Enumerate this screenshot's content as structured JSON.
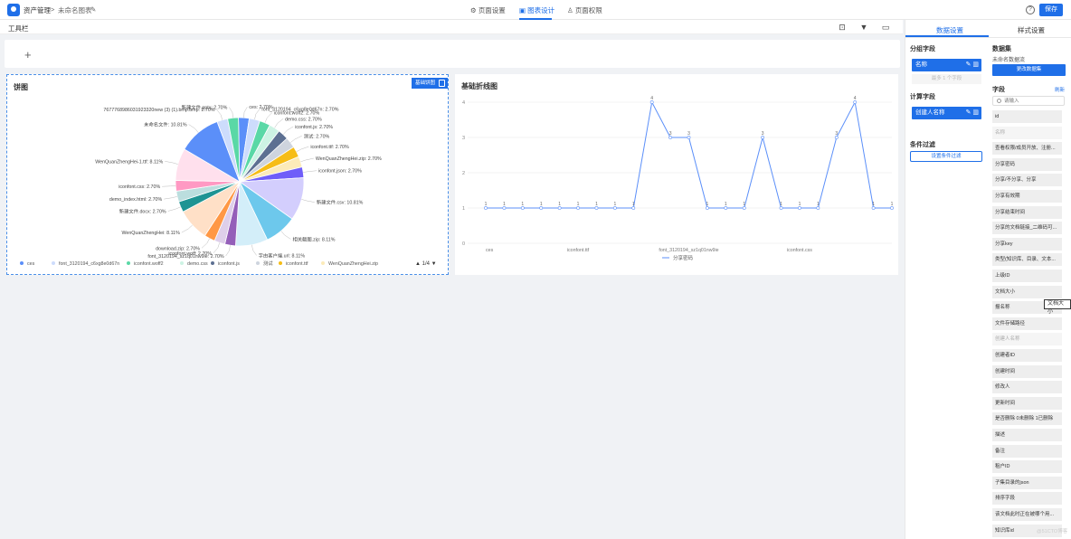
{
  "header": {
    "app_name": "资产管理",
    "separator": ">",
    "chart_name": "未命名图表",
    "tabs": [
      {
        "label": "页面设置",
        "icon": "gear-icon"
      },
      {
        "label": "图表设计",
        "icon": "chart-design-icon",
        "active": true
      },
      {
        "label": "页面权限",
        "icon": "user-permission-icon"
      }
    ],
    "save_label": "保存",
    "help_label": "?"
  },
  "toolbar": {
    "title": "工具栏",
    "add_label": "+"
  },
  "pie_card": {
    "title": "饼图",
    "badge_label": "基础饼图",
    "legend": [
      "ces",
      "font_3120194_c6xg8e0d67n",
      "iconfont.woff2",
      "demo.css",
      "iconfont.js",
      "测试",
      "iconfont.ttf",
      "WenQuanZhengHei.zip"
    ],
    "pager": "1/4"
  },
  "line_card": {
    "title": "基础折线图",
    "legend_label": "分享密码"
  },
  "right_panel": {
    "tabs": [
      "数据设置",
      "样式设置"
    ],
    "group_title": "分组字段",
    "group_field": "名称",
    "group_hint": "最多 1 个字段",
    "calc_title": "计算字段",
    "calc_field": "创建人名称",
    "filter_title": "条件过滤",
    "filter_button": "设置条件过滤",
    "dataset_title": "数据集",
    "dataset_name": "未命名数据流",
    "dataset_button": "更改数据集",
    "fields_title": "字段",
    "refresh_label": "刷新",
    "search_placeholder": "请输入",
    "fields": [
      "id",
      "名称",
      "查看权限/成员开放、注册...",
      "分享密码",
      "分享/不分享、分享",
      "分享有效期",
      "分享结束时间",
      "分享的文档链接_二维码可...",
      "分享key",
      "类型(知识库、目录、文本...",
      "上级ID",
      "文档大小",
      "报名称",
      "文件存储路径",
      "创建人名称",
      "创建者ID",
      "创建时间",
      "修改人",
      "更新时间",
      "是否删除 0未删除 1已删除",
      "描述",
      "备注",
      "租户ID",
      "子集目录的json",
      "排序字段",
      "该文档此时正在被哪个用...",
      "知识库id"
    ],
    "disabled_fields": [
      1,
      14
    ],
    "tooltip": "文档大小"
  },
  "watermark": "@51CTO博客",
  "colors": {
    "accent": "#1f6fe8"
  },
  "chart_data": [
    {
      "type": "pie",
      "title": "饼图",
      "slices": [
        {
          "label": "ces",
          "value": 2.7,
          "color": "#5b8ff9"
        },
        {
          "label": "font_3120194_c6xg8e0d67n",
          "value": 2.7,
          "color": "#cddcfc"
        },
        {
          "label": "iconfont.woff2",
          "value": 2.7,
          "color": "#5ad8a6"
        },
        {
          "label": "demo.css",
          "value": 2.7,
          "color": "#cdf3e4"
        },
        {
          "label": "iconfont.js",
          "value": 2.7,
          "color": "#5d7092"
        },
        {
          "label": "测试",
          "value": 2.7,
          "color": "#ced4de"
        },
        {
          "label": "iconfont.ttf",
          "value": 2.7,
          "color": "#f6bd16"
        },
        {
          "label": "WenQuanZhengHei.zip",
          "value": 2.7,
          "color": "#fcebb9"
        },
        {
          "label": "iconfont.json",
          "value": 2.7,
          "color": "#6f5ef9"
        },
        {
          "label": "新建文件.csv",
          "value": 10.81,
          "color": "#d3cefd"
        },
        {
          "label": "相关截图.zip",
          "value": 8.11,
          "color": "#6dc8ec"
        },
        {
          "label": "字由客户端.url",
          "value": 8.11,
          "color": "#d3eef9"
        },
        {
          "label": "font_3120194_sz1q01nw9ie",
          "value": 2.7,
          "color": "#945fb9"
        },
        {
          "label": "iconfont.woff",
          "value": 2.7,
          "color": "#decfea"
        },
        {
          "label": "download.zip",
          "value": 2.7,
          "color": "#ff9845"
        },
        {
          "label": "WenQuanZhengHei",
          "value": 8.11,
          "color": "#ffe0c7"
        },
        {
          "label": "新建文件.docx",
          "value": 2.7,
          "color": "#1e9493"
        },
        {
          "label": "demo_index.html",
          "value": 2.7,
          "color": "#bbdede"
        },
        {
          "label": "iconfont.css",
          "value": 2.7,
          "color": "#ff99c3"
        },
        {
          "label": "WenQuanZhengHei-1.ttf",
          "value": 8.11,
          "color": "#ffe0ed"
        },
        {
          "label": "未命名文件",
          "value": 10.81,
          "color": "#5b8ff9"
        },
        {
          "label": "7677768986031923320new (3) (1).bmp.bmp",
          "value": 2.7,
          "color": "#cddcfc"
        },
        {
          "label": "新建文件.pptx",
          "value": 2.7,
          "color": "#5ad8a6"
        }
      ],
      "label_format": "{label}: {value}%"
    },
    {
      "type": "line",
      "title": "基础折线图",
      "series": [
        {
          "name": "分享密码",
          "values": [
            1,
            1,
            1,
            1,
            1,
            1,
            1,
            1,
            1,
            4,
            3,
            3,
            1,
            1,
            1,
            3,
            1,
            1,
            1,
            3,
            4,
            1,
            1
          ]
        }
      ],
      "x_tick_labels": [
        "ces",
        "iconfont.ttf",
        "font_3120194_sz1q01nw9ie",
        "iconfont.css"
      ],
      "x_tick_indices": [
        0,
        5,
        11,
        17
      ],
      "ylim": [
        0,
        4
      ],
      "y_ticks": [
        0,
        1,
        2,
        3,
        4
      ],
      "data_labels": true,
      "grid": true,
      "legend_position": "bottom"
    }
  ]
}
